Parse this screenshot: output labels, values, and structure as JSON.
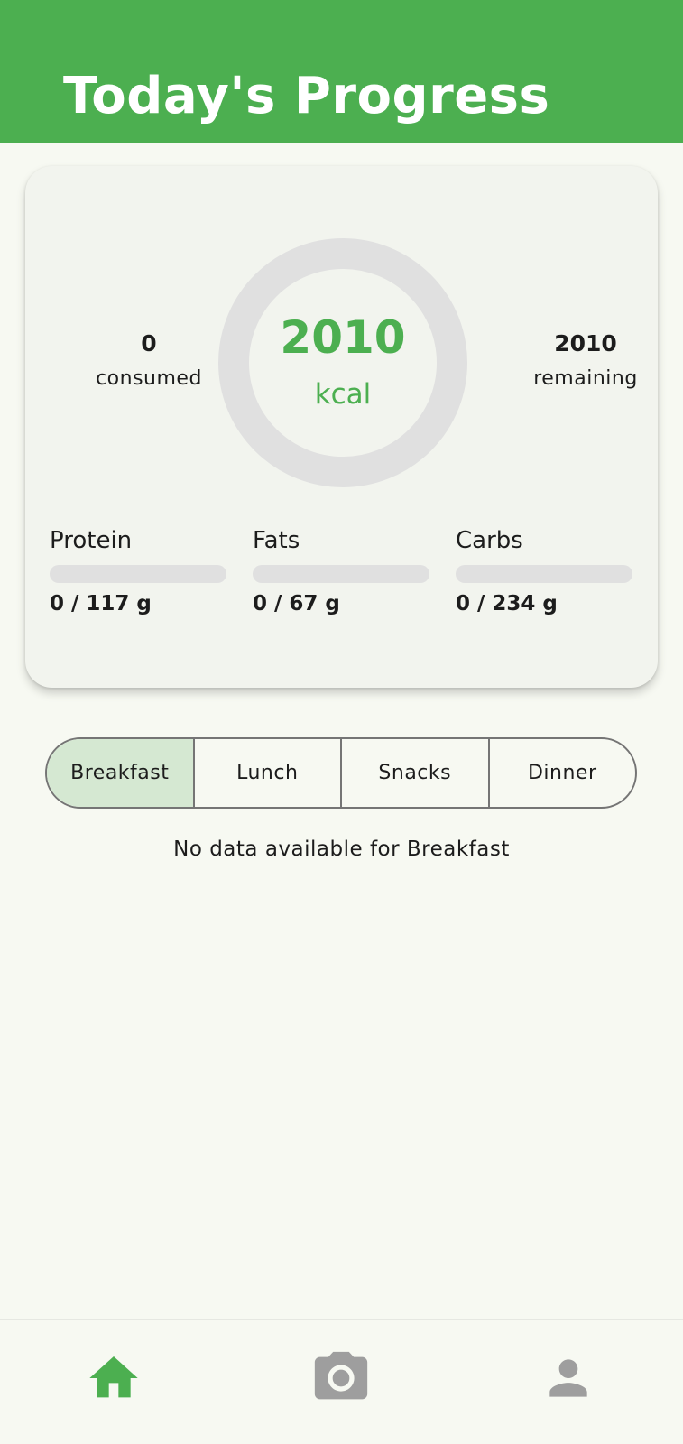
{
  "header": {
    "title": "Today's Progress",
    "color": "#4caf50"
  },
  "summary": {
    "consumed": {
      "value": "0",
      "label": "consumed"
    },
    "remaining": {
      "value": "2010",
      "label": "remaining"
    },
    "ring": {
      "value": "2010",
      "unit": "kcal",
      "progress": 0
    }
  },
  "macros": {
    "protein": {
      "name": "Protein",
      "value": "0 / 117 g",
      "progress": 0
    },
    "fats": {
      "name": "Fats",
      "value": "0 / 67 g",
      "progress": 0
    },
    "carbs": {
      "name": "Carbs",
      "value": "0 / 234 g",
      "progress": 0
    }
  },
  "meal_tabs": {
    "selected": "Breakfast",
    "items": [
      {
        "label": "Breakfast"
      },
      {
        "label": "Lunch"
      },
      {
        "label": "Snacks"
      },
      {
        "label": "Dinner"
      }
    ]
  },
  "empty_message": "No data available for Breakfast",
  "bottom_nav": {
    "active": "home-icon",
    "items": [
      {
        "icon": "home-icon"
      },
      {
        "icon": "camera-icon"
      },
      {
        "icon": "person-icon"
      }
    ]
  }
}
